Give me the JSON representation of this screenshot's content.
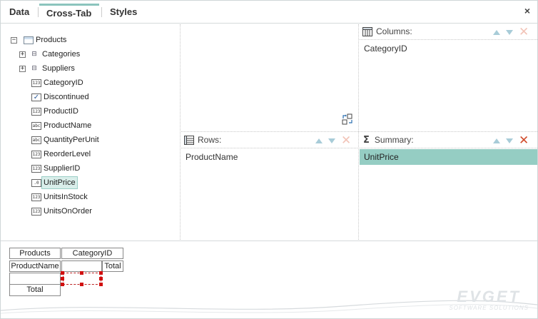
{
  "tabs": [
    {
      "label": "Data"
    },
    {
      "label": "Cross-Tab"
    },
    {
      "label": "Styles"
    }
  ],
  "close_label": "×",
  "tree": {
    "root": {
      "label": "Products",
      "expander": "−"
    },
    "relations": [
      {
        "label": "Categories",
        "expander": "+"
      },
      {
        "label": "Suppliers",
        "expander": "+"
      }
    ],
    "fields": [
      {
        "label": "CategoryID",
        "icon": "123"
      },
      {
        "label": "Discontinued",
        "icon": "✓"
      },
      {
        "label": "ProductID",
        "icon": "123"
      },
      {
        "label": "ProductName",
        "icon": "abc"
      },
      {
        "label": "QuantityPerUnit",
        "icon": "abc"
      },
      {
        "label": "ReorderLevel",
        "icon": "123"
      },
      {
        "label": "SupplierID",
        "icon": "123"
      },
      {
        "label": "UnitPrice",
        "icon": ".0"
      },
      {
        "label": "UnitsInStock",
        "icon": "123"
      },
      {
        "label": "UnitsOnOrder",
        "icon": "123"
      }
    ]
  },
  "columns_panel": {
    "title": "Columns:",
    "items": [
      "CategoryID"
    ]
  },
  "rows_panel": {
    "title": "Rows:",
    "items": [
      "ProductName"
    ]
  },
  "summary_panel": {
    "title": "Summary:",
    "icon": "Σ",
    "items": [
      "UnitPrice"
    ]
  },
  "preview": {
    "header_left": "Products",
    "header_col": "CategoryID",
    "row_header": "ProductName",
    "col_total": "Total",
    "row_total": "Total"
  },
  "watermark": {
    "big": "EVGET",
    "small": "SOFTWARE SOLUTIONS"
  },
  "colors": {
    "accent": "#8bc4bd",
    "selected": "#95cdc3",
    "delete": "#d14c2c"
  }
}
